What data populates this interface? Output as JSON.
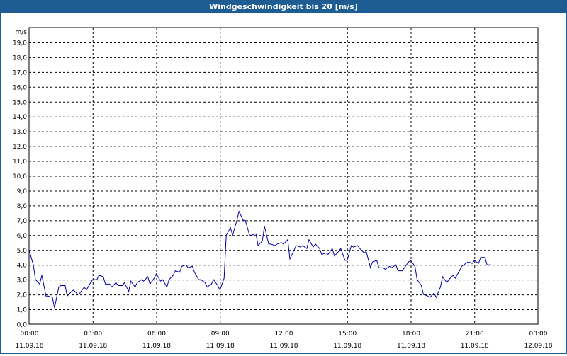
{
  "window": {
    "title": "Windgeschwindigkeit bis 20 [m/s]"
  },
  "colors": {
    "titlebar": "#1e5d94",
    "line": "#0000a0",
    "grid": "#000000",
    "background": "#ffffff"
  },
  "chart_data": {
    "type": "line",
    "title": "Windgeschwindigkeit bis 20 [m/s]",
    "ylabel": "m/s",
    "xlabel": "",
    "ylim": [
      0,
      20
    ],
    "xlim_hours": [
      0,
      24
    ],
    "grid": true,
    "y_ticks": [
      "0,0",
      "1,0",
      "2,0",
      "3,0",
      "4,0",
      "5,0",
      "6,0",
      "7,0",
      "8,0",
      "9,0",
      "10,0",
      "11,0",
      "12,0",
      "13,0",
      "14,0",
      "15,0",
      "16,0",
      "17,0",
      "18,0",
      "19,0"
    ],
    "x_ticks": [
      {
        "time": "00:00",
        "date": "11.09.18"
      },
      {
        "time": "03:00",
        "date": "11.09.18"
      },
      {
        "time": "06:00",
        "date": "11.09.18"
      },
      {
        "time": "09:00",
        "date": "11.09.18"
      },
      {
        "time": "12:00",
        "date": "11.09.18"
      },
      {
        "time": "15:00",
        "date": "11.09.18"
      },
      {
        "time": "18:00",
        "date": "11.09.18"
      },
      {
        "time": "21:00",
        "date": "11.09.18"
      },
      {
        "time": "00:00",
        "date": "12.09.18"
      }
    ],
    "series": [
      {
        "x_hours": [
          0.0,
          0.2,
          0.3,
          0.5,
          0.6,
          0.8,
          0.9,
          1.1,
          1.2,
          1.4,
          1.5,
          1.7,
          1.8,
          2.0,
          2.1,
          2.3,
          2.4,
          2.6,
          2.7,
          2.9,
          3.0,
          3.2,
          3.3,
          3.5,
          3.6,
          3.8,
          3.9,
          4.1,
          4.2,
          4.4,
          4.5,
          4.7,
          4.8,
          5.0,
          5.1,
          5.3,
          5.4,
          5.6,
          5.7,
          5.9,
          6.0,
          6.2,
          6.3,
          6.5,
          6.6,
          6.8,
          6.9,
          7.1,
          7.2,
          7.4,
          7.5,
          7.7,
          7.8,
          8.0,
          8.1,
          8.3,
          8.4,
          8.6,
          8.7,
          8.9,
          9.0,
          9.2,
          9.3,
          9.5,
          9.6,
          9.8,
          9.9,
          10.1,
          10.2,
          10.4,
          10.5,
          10.7,
          10.8,
          11.0,
          11.1,
          11.3,
          11.4,
          11.6,
          11.7,
          11.9,
          12.0,
          12.2,
          12.3,
          12.5,
          12.6,
          12.8,
          12.9,
          13.1,
          13.2,
          13.4,
          13.5,
          13.7,
          13.8,
          14.0,
          14.1,
          14.3,
          14.4,
          14.6,
          14.7,
          14.9,
          15.0,
          15.2,
          15.3,
          15.5,
          15.6,
          15.8,
          15.9,
          16.1,
          16.2,
          16.4,
          16.5,
          16.7,
          16.8,
          17.0,
          17.1,
          17.3,
          17.4,
          17.6,
          17.7,
          17.9,
          18.0,
          18.2,
          18.3,
          18.5,
          18.6,
          18.8,
          18.9,
          19.1,
          19.2,
          19.4,
          19.5,
          19.7,
          19.8,
          20.0,
          20.1,
          20.3,
          20.4,
          20.6,
          20.7,
          20.9,
          21.0,
          21.2,
          21.3,
          21.5,
          21.6,
          21.8,
          21.9,
          22.1,
          22.2,
          22.4,
          22.5,
          22.7,
          22.8,
          23.0,
          23.1,
          23.3,
          23.4,
          23.6,
          23.7,
          23.9
        ],
        "values": [
          5.0,
          4.0,
          3.0,
          2.7,
          3.3,
          1.9,
          1.9,
          1.8,
          1.1,
          2.5,
          2.6,
          2.6,
          1.9,
          2.2,
          2.3,
          2.0,
          2.1,
          2.5,
          2.3,
          2.8,
          3.0,
          3.0,
          3.3,
          3.2,
          2.7,
          2.7,
          2.5,
          2.8,
          2.6,
          2.6,
          2.8,
          2.2,
          2.9,
          2.5,
          2.8,
          3.0,
          2.9,
          3.2,
          2.7,
          3.1,
          3.4,
          2.9,
          3.0,
          2.5,
          3.0,
          3.3,
          3.6,
          3.5,
          3.9,
          4.0,
          3.8,
          3.9,
          3.5,
          3.0,
          3.0,
          2.8,
          2.5,
          2.7,
          3.0,
          2.6,
          2.3,
          3.1,
          6.0,
          6.5,
          6.0,
          7.0,
          7.6,
          7.0,
          7.0,
          6.0,
          6.0,
          6.1,
          5.3,
          5.6,
          6.6,
          5.4,
          5.4,
          5.3,
          5.4,
          5.5,
          5.4,
          5.7,
          4.4,
          5.0,
          5.3,
          5.2,
          5.3,
          5.1,
          5.7,
          5.2,
          5.4,
          5.1,
          4.7,
          4.8,
          4.7,
          5.1,
          4.6,
          4.9,
          5.1,
          4.3,
          4.3,
          5.3,
          5.2,
          5.3,
          5.1,
          4.8,
          4.9,
          3.8,
          4.2,
          4.3,
          3.8,
          3.8,
          3.7,
          3.9,
          3.8,
          4.0,
          3.6,
          3.6,
          3.8,
          4.2,
          4.3,
          3.9,
          3.0,
          2.6,
          2.0,
          1.9,
          1.8,
          2.1,
          1.8,
          2.5,
          3.2,
          2.8,
          3.0,
          3.3,
          3.1,
          3.6,
          3.9,
          4.1,
          4.2,
          4.1,
          4.3,
          4.1,
          4.5,
          4.5,
          4.0,
          4.0
        ]
      }
    ]
  }
}
